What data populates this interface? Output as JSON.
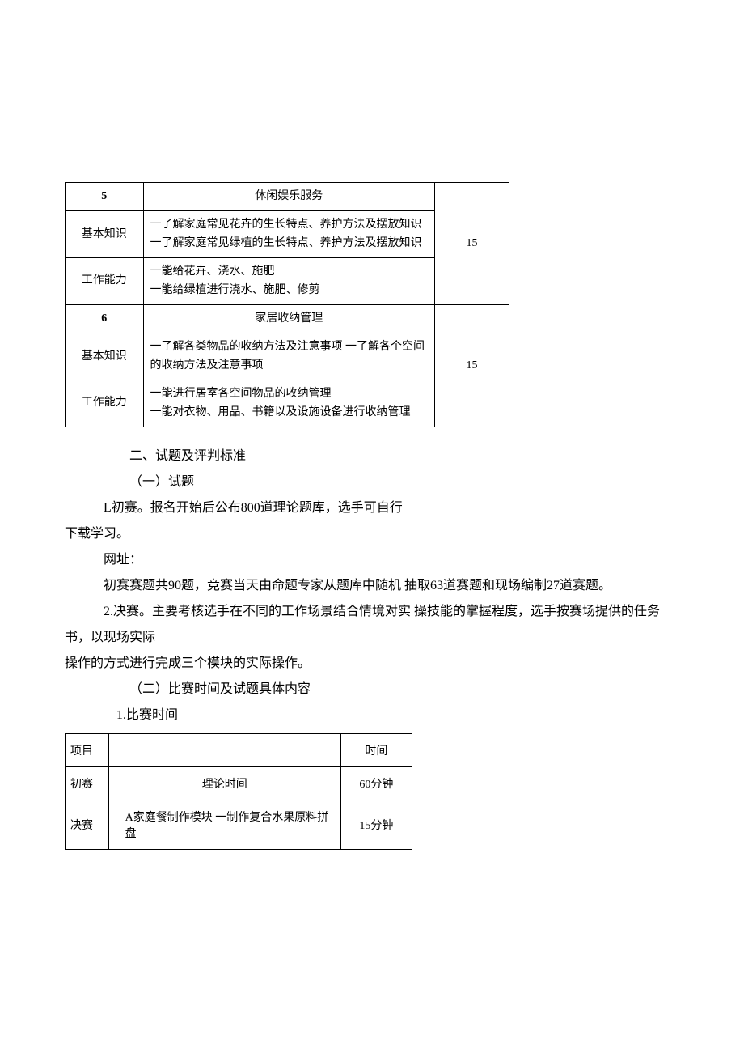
{
  "table1": {
    "section5": {
      "num": "5",
      "title": "休闲娱乐服务",
      "score": "15",
      "rows": [
        {
          "label": "基本知识",
          "content": "一了解家庭常见花卉的生长特点、养护方法及摆放知识 一了解家庭常见绿植的生长特点、养护方法及摆放知识"
        },
        {
          "label": "工作能力",
          "content": "一能给花卉、浇水、施肥\n一能给绿植进行浇水、施肥、修剪"
        }
      ]
    },
    "section6": {
      "num": "6",
      "title": "家居收纳管理",
      "score": "15",
      "rows": [
        {
          "label": "基本知识",
          "content": "一了解各类物品的收纳方法及注意事项 一了解各个空间的收纳方法及注意事项"
        },
        {
          "label": "工作能力",
          "content": "一能进行居室各空间物品的收纳管理\n一能对衣物、用品、书籍以及设施设备进行收纳管理"
        }
      ]
    }
  },
  "body": {
    "h2": "二、试题及评判标准",
    "h2_1": "（一）试题",
    "p1a": "L初赛。报名开始后公布800道理论题库，选手可自行",
    "p1b": "下载学习。",
    "p2": "网址：",
    "p3": "初赛赛题共90题，竞赛当天由命题专家从题库中随机 抽取63道赛题和现场编制27道赛题。",
    "p4a": "2.决赛。主要考核选手在不同的工作场景结合情境对实   操技能的掌握程度，选手按赛场提供的任务书，以现场实际",
    "p4b": "操作的方式进行完成三个模块的实际操作。",
    "h2_2": "（二）比赛时间及试题具体内容",
    "h3": "1.比赛时间"
  },
  "table2": {
    "header": {
      "c1": "项目",
      "c2": "",
      "c3": "时间"
    },
    "rows": [
      {
        "c1": "初赛",
        "c2": "理论时间",
        "c3": "60分钟",
        "align": "center"
      },
      {
        "c1": "决赛",
        "c2": "A家庭餐制作模块 一制作复合水果原料拼盘",
        "c3": "15分钟",
        "align": "bottom"
      }
    ]
  }
}
